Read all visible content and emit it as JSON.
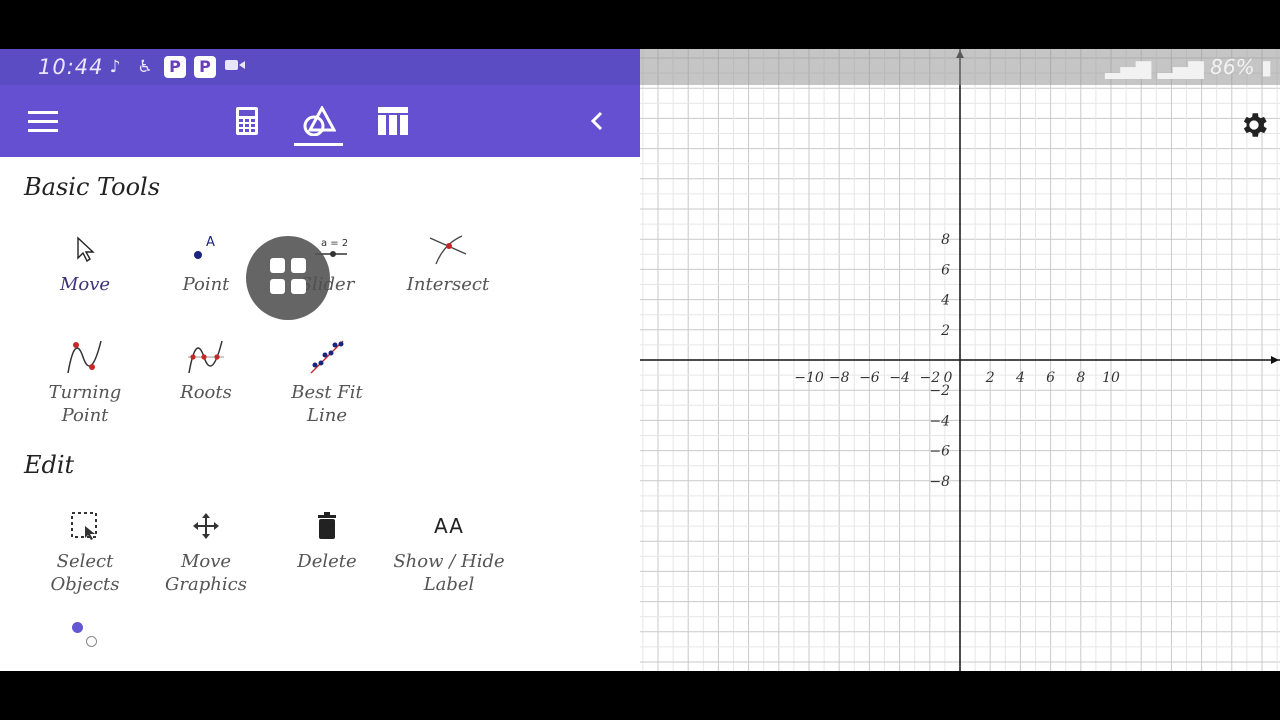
{
  "status_bar": {
    "time": "10:44",
    "notification_icons": [
      "music-note-icon",
      "accessibility-icon",
      "p-app-icon",
      "p-app-icon",
      "video-icon"
    ],
    "p_glyph": "P",
    "battery": "86%"
  },
  "toolbar": {
    "tabs": [
      {
        "name": "calculator-tab-icon"
      },
      {
        "name": "tools-tab-icon",
        "selected": true
      },
      {
        "name": "table-tab-icon"
      }
    ]
  },
  "sections": {
    "basic_title": "Basic Tools",
    "edit_title": "Edit"
  },
  "basic_tools": {
    "move": "Move",
    "point": "Point",
    "slider": "Slider",
    "slider_icon_text": "a = 2",
    "point_icon_text": "A",
    "intersect": "Intersect",
    "turning_point_1": "Turning",
    "turning_point_2": "Point",
    "roots": "Roots",
    "best_fit_line": "Best Fit Line"
  },
  "edit_tools": {
    "select_1": "Select",
    "select_2": "Objects",
    "move_graphics_1": "Move",
    "move_graphics_2": "Graphics",
    "delete": "Delete",
    "show_hide_1": "Show / Hide",
    "show_hide_2": "Label",
    "show_hide_icon_text": "AA"
  },
  "graph": {
    "x_ticks": [
      "−10",
      "−8",
      "−6",
      "−4",
      "−2",
      "0",
      "2",
      "4",
      "6",
      "8",
      "10"
    ],
    "y_ticks": [
      "8",
      "6",
      "4",
      "2",
      "−2",
      "−4",
      "−6",
      "−8"
    ],
    "x_range": [
      -10.5,
      10.5
    ],
    "y_range": [
      -10,
      10
    ],
    "grid": true
  },
  "colors": {
    "toolbar": "#6450d0",
    "status_left": "#5b4cc4",
    "point_blue": "#1a237e",
    "point_red": "#c62828"
  }
}
